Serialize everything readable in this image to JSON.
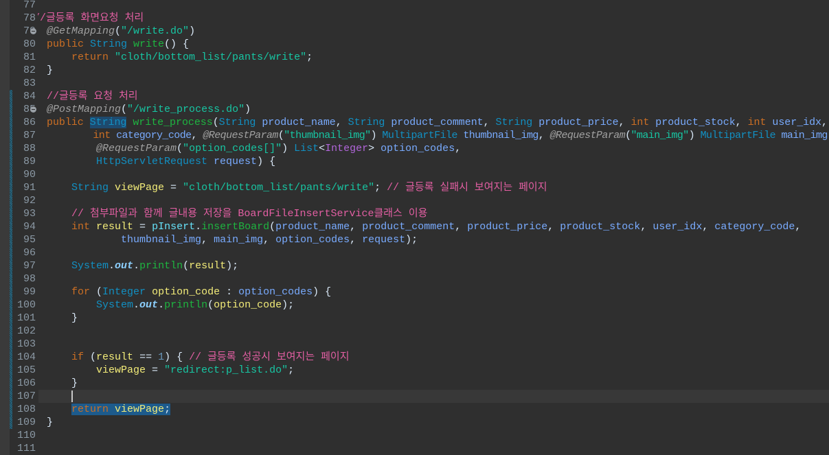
{
  "editor": {
    "lines": [
      {
        "n": 77,
        "t": []
      },
      {
        "n": 78,
        "t": [
          [
            "cm",
            "//글등록 화면요청 처리"
          ]
        ],
        "shift": -2
      },
      {
        "n": 79,
        "fold": true,
        "t": [
          [
            "an",
            "@GetMapping"
          ],
          [
            "pl",
            "("
          ],
          [
            "st",
            "\"/write.do\""
          ],
          [
            "pl",
            ")"
          ]
        ]
      },
      {
        "n": 80,
        "t": [
          [
            "kw",
            "public "
          ],
          [
            "ty",
            "String "
          ],
          [
            "me",
            "write"
          ],
          [
            "pl",
            "() {"
          ]
        ]
      },
      {
        "n": 81,
        "t": [
          [
            "pl",
            "    "
          ],
          [
            "kw",
            "return "
          ],
          [
            "st",
            "\"cloth/bottom_list/pants/write\""
          ],
          [
            "pl",
            ";"
          ]
        ]
      },
      {
        "n": 82,
        "t": [
          [
            "pl",
            "}"
          ]
        ]
      },
      {
        "n": 83,
        "t": []
      },
      {
        "n": 84,
        "chg": true,
        "t": [
          [
            "cm",
            "//글등록 요청 처리"
          ]
        ]
      },
      {
        "n": 85,
        "chg": true,
        "fold": true,
        "t": [
          [
            "an",
            "@PostMapping"
          ],
          [
            "pl",
            "("
          ],
          [
            "st",
            "\"/write_process.do\""
          ],
          [
            "pl",
            ")"
          ]
        ]
      },
      {
        "n": 86,
        "chg": true,
        "t": [
          [
            "kw",
            "public "
          ],
          [
            "ty occ",
            "String"
          ],
          [
            "pl",
            " "
          ],
          [
            "me",
            "write_process"
          ],
          [
            "pl",
            "("
          ],
          [
            "ty",
            "String "
          ],
          [
            "pa",
            "product_name"
          ],
          [
            "pl",
            ", "
          ],
          [
            "ty",
            "String "
          ],
          [
            "pa",
            "product_comment"
          ],
          [
            "pl",
            ", "
          ],
          [
            "ty",
            "String "
          ],
          [
            "pa",
            "product_price"
          ],
          [
            "pl",
            ", "
          ],
          [
            "kw",
            "int "
          ],
          [
            "pa",
            "product_stock"
          ],
          [
            "pl",
            ", "
          ],
          [
            "kw",
            "int "
          ],
          [
            "pa",
            "user_idx"
          ],
          [
            "pl",
            ","
          ]
        ]
      },
      {
        "n": 87,
        "chg": true,
        "t": [
          [
            "pl",
            "        "
          ],
          [
            "kw",
            "int "
          ],
          [
            "pa",
            "category_code"
          ],
          [
            "pl",
            ", "
          ],
          [
            "an",
            "@RequestParam"
          ],
          [
            "pl",
            "("
          ],
          [
            "st",
            "\"thumbnail_img\""
          ],
          [
            "pl",
            ") "
          ],
          [
            "ty",
            "MultipartFile "
          ],
          [
            "pa",
            "thumbnail_img"
          ],
          [
            "pl",
            ", "
          ],
          [
            "an",
            "@RequestParam"
          ],
          [
            "pl",
            "("
          ],
          [
            "st",
            "\"main_img\""
          ],
          [
            "pl",
            ") "
          ],
          [
            "ty",
            "MultipartFile "
          ],
          [
            "pa",
            "main_img"
          ]
        ]
      },
      {
        "n": 88,
        "chg": true,
        "t": [
          [
            "pl",
            "        "
          ],
          [
            "an",
            "@RequestParam"
          ],
          [
            "pl",
            "("
          ],
          [
            "st",
            "\"option_codes[]\""
          ],
          [
            "pl",
            ") "
          ],
          [
            "ty",
            "List"
          ],
          [
            "pl",
            "<"
          ],
          [
            "ge",
            "Integer"
          ],
          [
            "pl",
            "> "
          ],
          [
            "pa",
            "option_codes"
          ],
          [
            "pl",
            ","
          ]
        ]
      },
      {
        "n": 89,
        "chg": true,
        "t": [
          [
            "pl",
            "        "
          ],
          [
            "ty",
            "HttpServletRequest "
          ],
          [
            "pa",
            "request"
          ],
          [
            "pl",
            ") {"
          ]
        ]
      },
      {
        "n": 90,
        "chg": true,
        "t": []
      },
      {
        "n": 91,
        "chg": true,
        "t": [
          [
            "pl",
            "    "
          ],
          [
            "ty",
            "String "
          ],
          [
            "lo",
            "viewPage"
          ],
          [
            "pl",
            " = "
          ],
          [
            "st",
            "\"cloth/bottom_list/pants/write\""
          ],
          [
            "pl",
            "; "
          ],
          [
            "cm",
            "// 글등록 실패시 보여지는 페이지"
          ]
        ]
      },
      {
        "n": 92,
        "chg": true,
        "t": []
      },
      {
        "n": 93,
        "chg": true,
        "t": [
          [
            "pl",
            "    "
          ],
          [
            "cm",
            "// 첨부파일과 함께 글내용 저장을 BoardFileInsertService클래스 이용"
          ]
        ]
      },
      {
        "n": 94,
        "chg": true,
        "t": [
          [
            "pl",
            "    "
          ],
          [
            "kw",
            "int "
          ],
          [
            "lo",
            "result"
          ],
          [
            "pl",
            " = "
          ],
          [
            "fl",
            "pInsert"
          ],
          [
            "pl",
            "."
          ],
          [
            "me",
            "insertBoard"
          ],
          [
            "pl",
            "("
          ],
          [
            "pa",
            "product_name"
          ],
          [
            "pl",
            ", "
          ],
          [
            "pa",
            "product_comment"
          ],
          [
            "pl",
            ", "
          ],
          [
            "pa",
            "product_price"
          ],
          [
            "pl",
            ", "
          ],
          [
            "pa",
            "product_stock"
          ],
          [
            "pl",
            ", "
          ],
          [
            "pa",
            "user_idx"
          ],
          [
            "pl",
            ", "
          ],
          [
            "pa",
            "category_code"
          ],
          [
            "pl",
            ","
          ]
        ]
      },
      {
        "n": 95,
        "chg": true,
        "t": [
          [
            "pl",
            "            "
          ],
          [
            "pa",
            "thumbnail_img"
          ],
          [
            "pl",
            ", "
          ],
          [
            "pa",
            "main_img"
          ],
          [
            "pl",
            ", "
          ],
          [
            "pa",
            "option_codes"
          ],
          [
            "pl",
            ", "
          ],
          [
            "pa",
            "request"
          ],
          [
            "pl",
            ");"
          ]
        ]
      },
      {
        "n": 96,
        "chg": true,
        "t": []
      },
      {
        "n": 97,
        "chg": true,
        "t": [
          [
            "pl",
            "    "
          ],
          [
            "ty",
            "System"
          ],
          [
            "pl",
            "."
          ],
          [
            "fi",
            "out"
          ],
          [
            "pl",
            "."
          ],
          [
            "me",
            "println"
          ],
          [
            "pl",
            "("
          ],
          [
            "lo",
            "result"
          ],
          [
            "pl",
            ");"
          ]
        ]
      },
      {
        "n": 98,
        "chg": true,
        "t": []
      },
      {
        "n": 99,
        "chg": true,
        "t": [
          [
            "pl",
            "    "
          ],
          [
            "kw",
            "for "
          ],
          [
            "pl",
            "("
          ],
          [
            "ty",
            "Integer "
          ],
          [
            "lo",
            "option_code"
          ],
          [
            "pl",
            " : "
          ],
          [
            "pa",
            "option_codes"
          ],
          [
            "pl",
            ") {"
          ]
        ]
      },
      {
        "n": 100,
        "chg": true,
        "t": [
          [
            "pl",
            "        "
          ],
          [
            "ty",
            "System"
          ],
          [
            "pl",
            "."
          ],
          [
            "fi",
            "out"
          ],
          [
            "pl",
            "."
          ],
          [
            "me",
            "println"
          ],
          [
            "pl",
            "("
          ],
          [
            "lo",
            "option_code"
          ],
          [
            "pl",
            ");"
          ]
        ]
      },
      {
        "n": 101,
        "chg": true,
        "t": [
          [
            "pl",
            "    }"
          ]
        ]
      },
      {
        "n": 102,
        "chg": true,
        "t": []
      },
      {
        "n": 103,
        "chg": true,
        "t": []
      },
      {
        "n": 104,
        "chg": true,
        "t": [
          [
            "pl",
            "    "
          ],
          [
            "kw",
            "if "
          ],
          [
            "pl",
            "("
          ],
          [
            "lo",
            "result"
          ],
          [
            "pl",
            " == "
          ],
          [
            "nu",
            "1"
          ],
          [
            "pl",
            ") { "
          ],
          [
            "cm",
            "// 글등록 성공시 보여지는 페이지"
          ]
        ]
      },
      {
        "n": 105,
        "chg": true,
        "t": [
          [
            "pl",
            "        "
          ],
          [
            "lo",
            "viewPage"
          ],
          [
            "pl",
            " = "
          ],
          [
            "st",
            "\"redirect:p_list.do\""
          ],
          [
            "pl",
            ";"
          ]
        ]
      },
      {
        "n": 106,
        "chg": true,
        "t": [
          [
            "pl",
            "    }"
          ]
        ]
      },
      {
        "n": 107,
        "chg": true,
        "current": true,
        "t": []
      },
      {
        "n": 108,
        "chg": true,
        "t": [
          [
            "pl",
            "    "
          ],
          [
            "kw sel",
            "return"
          ],
          [
            "pl sel",
            " "
          ],
          [
            "lo sel",
            "viewPage"
          ],
          [
            "pl sel",
            ";"
          ]
        ]
      },
      {
        "n": 109,
        "chg": true,
        "t": [
          [
            "pl",
            "}"
          ]
        ]
      },
      {
        "n": 110,
        "t": []
      },
      {
        "n": 111,
        "t": []
      }
    ]
  },
  "colors": {
    "background": "#2f2f2f",
    "keyword": "#cc6f24",
    "type": "#1290c3",
    "string": "#17c6a3",
    "comment": "#e35fa3",
    "selection": "#1d5b8c"
  }
}
